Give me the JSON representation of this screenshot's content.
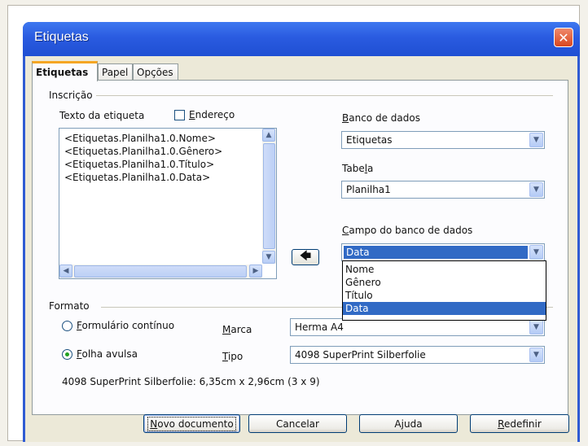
{
  "window": {
    "title": "Etiquetas",
    "close_glyph": "✕"
  },
  "tabs": [
    {
      "label": "Etiquetas",
      "active": true
    },
    {
      "label": "Papel",
      "active": false
    },
    {
      "label": "Opções",
      "active": false
    }
  ],
  "inscricao": {
    "group_label": "Inscrição",
    "texto_label": "Texto da etiqueta",
    "endereco_label": "Endereço",
    "endereco_checked": false,
    "lines": [
      "<Etiquetas.Planilha1.0.Nome>",
      "<Etiquetas.Planilha1.0.Gênero>",
      "<Etiquetas.Planilha1.0.Título>",
      "<Etiquetas.Planilha1.0.Data>"
    ],
    "insert_arrow_glyph": "🡄",
    "banco_label": "Banco de dados",
    "banco_value": "Etiquetas",
    "tabela_label": "Tabela",
    "tabela_value": "Planilha1",
    "campo_label": "Campo do banco de dados",
    "campo_value": "Data",
    "campo_options": [
      "Nome",
      "Gênero",
      "Título",
      "Data"
    ],
    "campo_selected_index": 3
  },
  "formato": {
    "group_label": "Formato",
    "radio_continuo": "Formulário contínuo",
    "radio_avulsa": "Folha avulsa",
    "selected": "avulsa",
    "marca_label": "Marca",
    "marca_value": "Herma A4",
    "tipo_label": "Tipo",
    "tipo_value": "4098 SuperPrint Silberfolie",
    "info": "4098 SuperPrint Silberfolie: 6,35cm x 2,96cm (3 x 9)"
  },
  "buttons": {
    "novo": "Novo documento",
    "cancelar": "Cancelar",
    "ajuda": "Ajuda",
    "redefinir": "Redefinir"
  },
  "icons": {
    "scroll_up": "▲",
    "scroll_down": "▼",
    "scroll_left": "◀",
    "scroll_right": "▶",
    "dropdown": "▼"
  }
}
